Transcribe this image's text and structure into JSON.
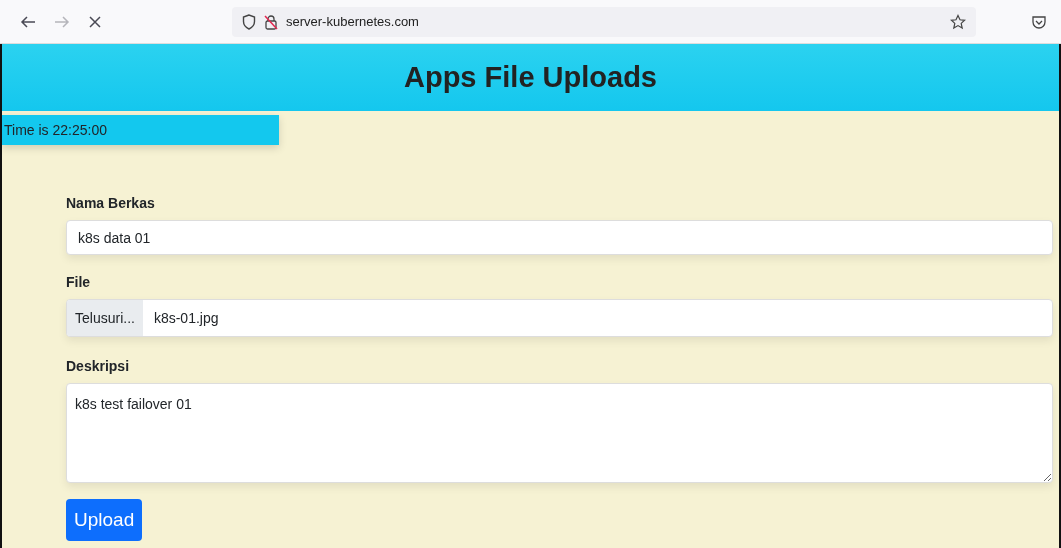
{
  "browser": {
    "url": "server-kubernetes.com",
    "back_disabled": false,
    "forward_disabled": true,
    "loading": true
  },
  "header": {
    "title": "Apps File Uploads"
  },
  "clock": {
    "text": "Time is 22:25:00"
  },
  "form": {
    "fields": [
      {
        "kind": "text",
        "label": "Nama Berkas",
        "value": "k8s data 01"
      },
      {
        "kind": "file",
        "label": "File",
        "button": "Telusuri...",
        "value": "k8s-01.jpg"
      },
      {
        "kind": "textarea",
        "label": "Deskripsi",
        "value": "k8s test failover 01"
      }
    ],
    "submit": "Upload"
  }
}
